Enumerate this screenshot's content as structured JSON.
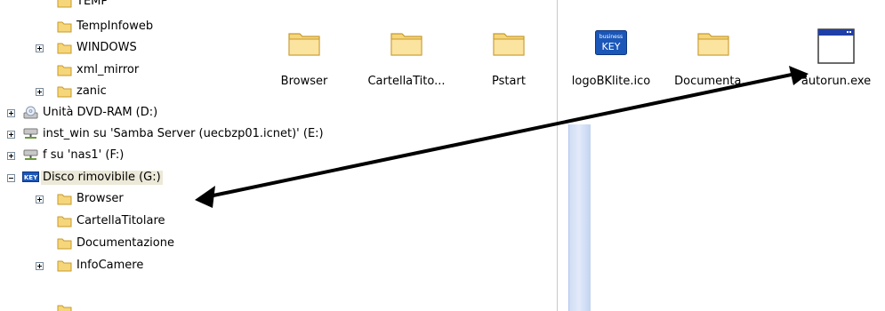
{
  "tree": {
    "partial_top": "TEMP",
    "items": [
      {
        "label": "TempInfoweb"
      },
      {
        "label": "WINDOWS"
      },
      {
        "label": "xml_mirror"
      },
      {
        "label": "zanic"
      },
      {
        "label": "Unità DVD-RAM (D:)"
      },
      {
        "label": "inst_win su 'Samba Server (uecbzp01.icnet)' (E:)"
      },
      {
        "label": "f su 'nas1' (F:)"
      },
      {
        "label": "Disco rimovibile (G:)"
      },
      {
        "label": "Browser"
      },
      {
        "label": "CartellaTitolare"
      },
      {
        "label": "Documentazione"
      },
      {
        "label": "InfoCamere"
      }
    ]
  },
  "files": {
    "items": [
      {
        "name": "Browser",
        "icon": "folder-icon"
      },
      {
        "name": "CartellaTito...",
        "icon": "folder-icon"
      },
      {
        "name": "Pstart",
        "icon": "folder-icon"
      },
      {
        "name": "logoBKlite.ico",
        "icon": "business-key-icon",
        "logo_lines": [
          "business",
          "KEY"
        ]
      },
      {
        "name": "Documenta...",
        "icon": "folder-icon"
      },
      {
        "name": "autorun.exe",
        "icon": "application-window-icon"
      }
    ]
  },
  "colors": {
    "folder": "#f6d67a",
    "folder_edge": "#c79a2c",
    "key_blue": "#1b57b8",
    "arrow": "#000000"
  }
}
